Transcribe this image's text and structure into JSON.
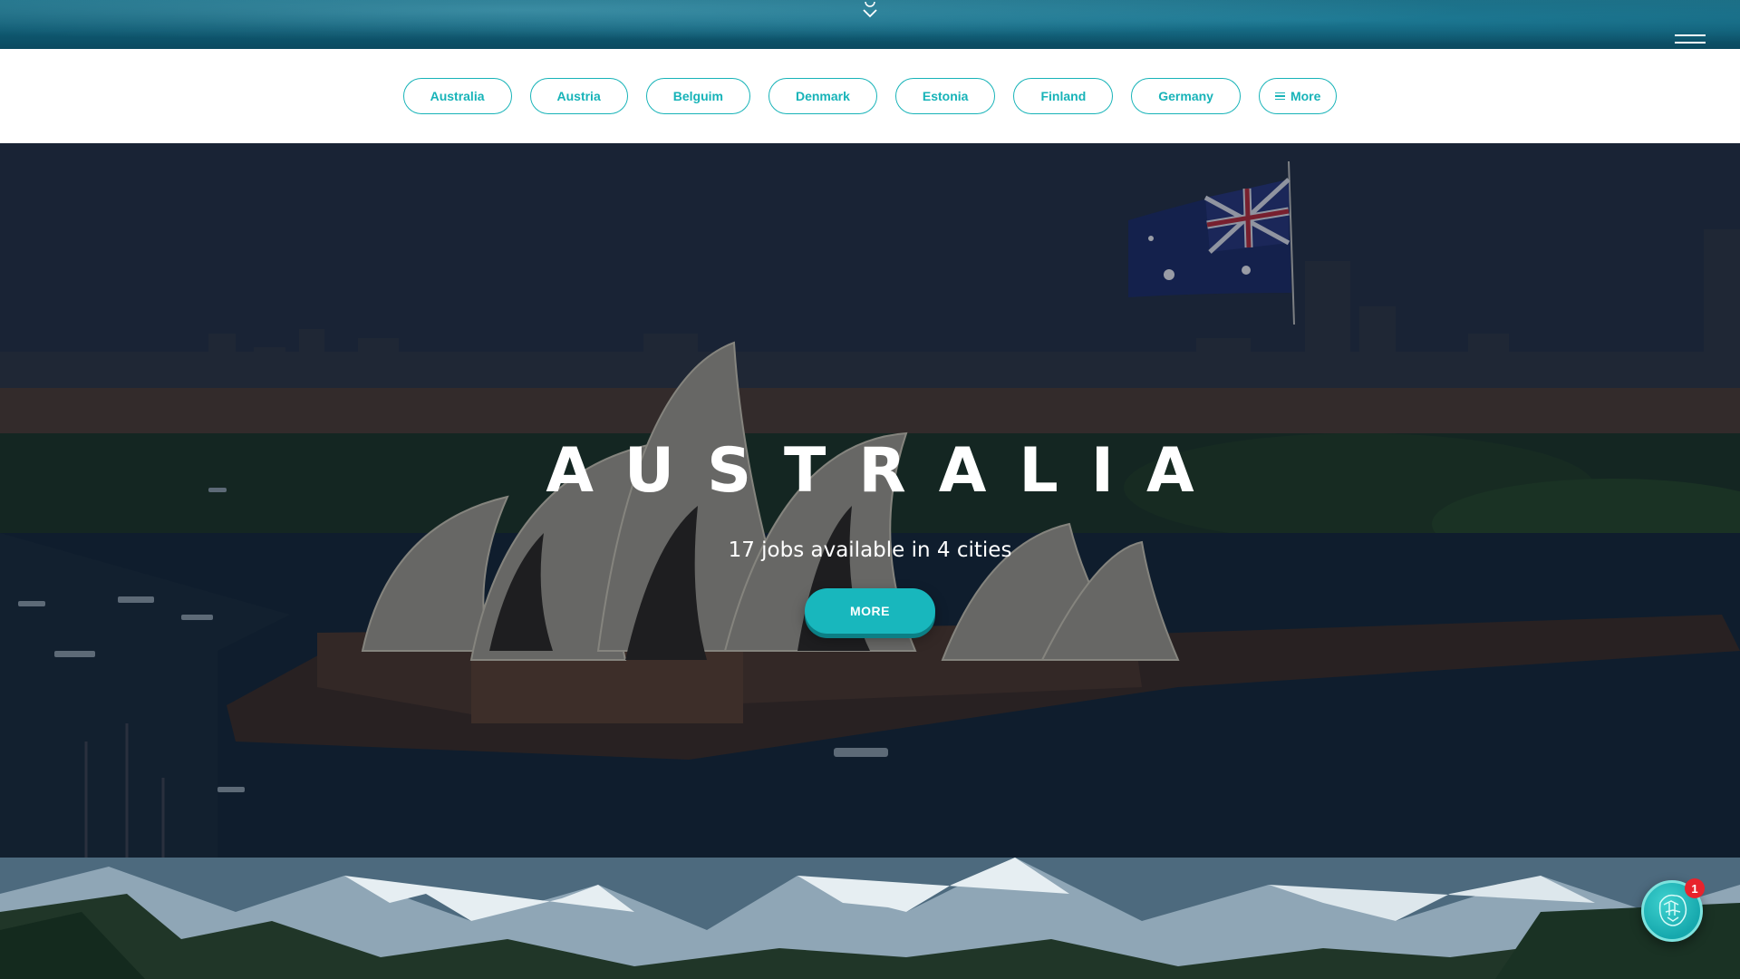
{
  "header": {
    "scroll_hint_icon": "chevron-down-icon",
    "menu_icon": "hamburger-menu-icon"
  },
  "country_nav": {
    "items": [
      "Australia",
      "Austria",
      "Belguim",
      "Denmark",
      "Estonia",
      "Finland",
      "Germany"
    ],
    "more_label": "More",
    "more_icon": "list-icon"
  },
  "hero": {
    "title": "AUSTRALIA",
    "subtitle": "17 jobs available in 4 cities",
    "button_label": "MORE"
  },
  "chat": {
    "icon": "chat-mascot-icon",
    "badge_count": "1"
  },
  "colors": {
    "accent": "#17b3b8",
    "badge": "#e8232c",
    "nav_background": "#ffffff"
  }
}
